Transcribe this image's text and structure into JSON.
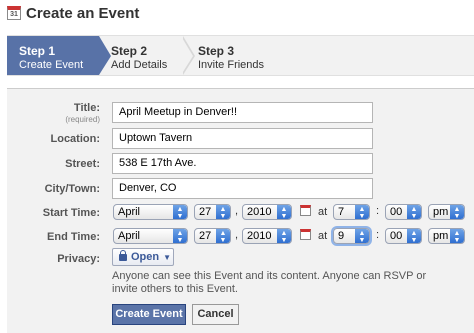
{
  "header": {
    "title": "Create an Event",
    "icon": "calendar-icon",
    "icon_text": "31"
  },
  "steps": [
    {
      "num": "Step 1",
      "label": "Create Event",
      "active": true
    },
    {
      "num": "Step 2",
      "label": "Add Details",
      "active": false
    },
    {
      "num": "Step 3",
      "label": "Invite Friends",
      "active": false
    }
  ],
  "form": {
    "title": {
      "label": "Title:",
      "sub": "(required)",
      "value": "April Meetup in Denver!!"
    },
    "location": {
      "label": "Location:",
      "value": "Uptown Tavern"
    },
    "street": {
      "label": "Street:",
      "value": "538 E 17th Ave."
    },
    "city": {
      "label": "City/Town:",
      "value": "Denver, CO"
    },
    "start": {
      "label": "Start Time:",
      "month": "April",
      "day": "27",
      "year": "2010",
      "at": "at",
      "hour": "7",
      "minute": "00",
      "ampm": "pm"
    },
    "end": {
      "label": "End Time:",
      "month": "April",
      "day": "27",
      "year": "2010",
      "at": "at",
      "hour": "9",
      "minute": "00",
      "ampm": "pm"
    },
    "privacy": {
      "label": "Privacy:",
      "value": "Open",
      "help": "Anyone can see this Event and its content. Anyone can RSVP or invite others to this Event."
    }
  },
  "buttons": {
    "create": "Create Event",
    "cancel": "Cancel"
  },
  "colors": {
    "accent": "#5872a7",
    "link": "#3b5998",
    "panel": "#f2f2f2"
  }
}
